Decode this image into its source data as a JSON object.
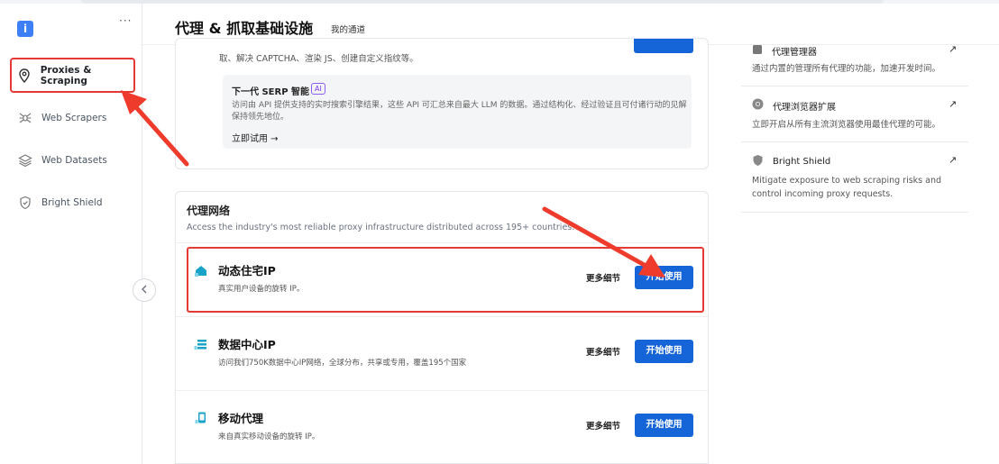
{
  "sidebar": {
    "logo_letter": "i",
    "more_label": "···",
    "items": [
      {
        "label": "Proxies & Scraping",
        "icon": "location-pin-icon"
      },
      {
        "label": "Web Scrapers",
        "icon": "spider-icon"
      },
      {
        "label": "Web Datasets",
        "icon": "layers-icon"
      },
      {
        "label": "Bright Shield",
        "icon": "shield-icon"
      }
    ],
    "collapse_icon": "chevron-left-icon"
  },
  "header": {
    "title": "代理 & 抓取基础设施",
    "subtitle": "我的通道"
  },
  "top_card": {
    "desc_line2": "取、解决 CAPTCHA、渲染 JS、创建自定义指纹等。",
    "serp": {
      "title": "下一代 SERP 智能",
      "badge": "AI",
      "desc": "访问由 API 提供支持的实时搜索引擎结果，这些 API 可汇总来自最大 LLM 的数据。通过结构化、经过验证且可付诸行动的见解保持领先地位。",
      "link": "立即试用 →"
    }
  },
  "proxy_network": {
    "title": "代理网络",
    "desc": "Access the industry's most reliable proxy infrastructure distributed across 195+ countries.",
    "rows": [
      {
        "title": "动态住宅IP",
        "sub": "真实用户设备的旋转 IP。",
        "more": "更多细节",
        "button": "开始使用",
        "icon": "house-icon"
      },
      {
        "title": "数据中心IP",
        "sub": "访问我们750K数据中心IP网络，全球分布，共享或专用，覆盖195个国家",
        "more": "更多细节",
        "button": "开始使用",
        "icon": "server-icon"
      },
      {
        "title": "移动代理",
        "sub": "来自真实移动设备的旋转 IP。",
        "more": "更多细节",
        "button": "开始使用",
        "icon": "mobile-icon"
      }
    ]
  },
  "right_panel": {
    "items": [
      {
        "title": "代理管理器",
        "desc": "通过内置的管理所有代理的功能，加速开发时间。",
        "arrow": "↗",
        "icon": "proxy-manager-icon"
      },
      {
        "title": "代理浏览器扩展",
        "desc": "立即开启从所有主流浏览器使用最佳代理的可能。",
        "arrow": "↗",
        "icon": "chrome-icon"
      },
      {
        "title": "Bright Shield",
        "desc": "Mitigate exposure to web scraping risks and control incoming proxy requests.",
        "arrow": "↗",
        "icon": "shield-icon"
      }
    ]
  },
  "colors": {
    "accent": "#1565d8",
    "highlight": "#e53935"
  }
}
